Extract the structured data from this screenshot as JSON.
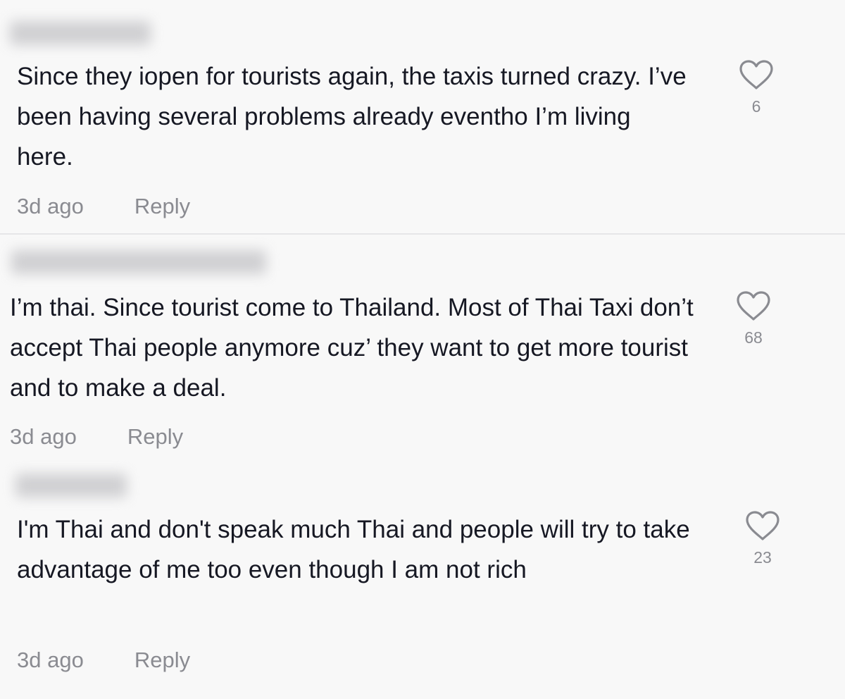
{
  "comments": [
    {
      "text": "Since they iopen for tourists again, the taxis turned crazy. I’ve been having several problems already eventho I’m living here.",
      "time": "3d ago",
      "reply_label": "Reply",
      "likes": "6"
    },
    {
      "text": "I’m thai. Since tourist come to Thailand. Most of Thai Taxi don’t accept Thai people anymore cuz’ they want to get more tourist and to make a deal.",
      "time": "3d ago",
      "reply_label": "Reply",
      "likes": "68"
    },
    {
      "text": "I'm Thai and don't speak much Thai and people will try to take advantage of me too even though I am not rich",
      "time": "3d ago",
      "reply_label": "Reply",
      "likes": "23"
    }
  ],
  "icons": {
    "like": "heart-outline-icon"
  }
}
